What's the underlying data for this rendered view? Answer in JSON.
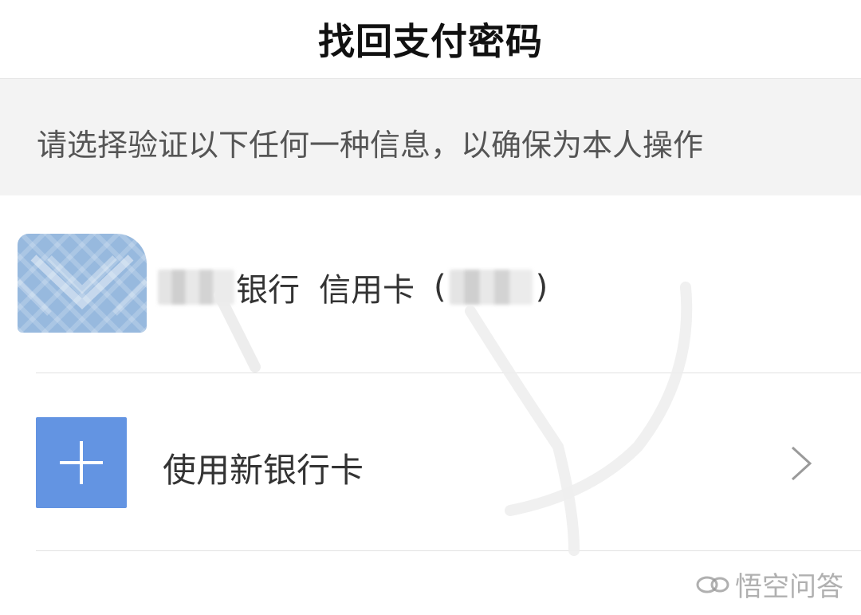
{
  "header": {
    "title": "找回支付密码"
  },
  "notice": {
    "text": "请选择验证以下任何一种信息，以确保为本人操作"
  },
  "existing_card": {
    "bank_suffix": "银行",
    "card_type": "信用卡",
    "paren_open": "(",
    "paren_close": ")",
    "logo_icon": "bank-logo-icon"
  },
  "new_card": {
    "label": "使用新银行卡",
    "add_icon": "plus-icon",
    "chevron_icon": "chevron-right-icon"
  },
  "watermark": {
    "text": "悟空问答"
  },
  "colors": {
    "accent": "#6394e2",
    "notice_bg": "#f3f3f3",
    "divider": "#e2e2e2"
  }
}
